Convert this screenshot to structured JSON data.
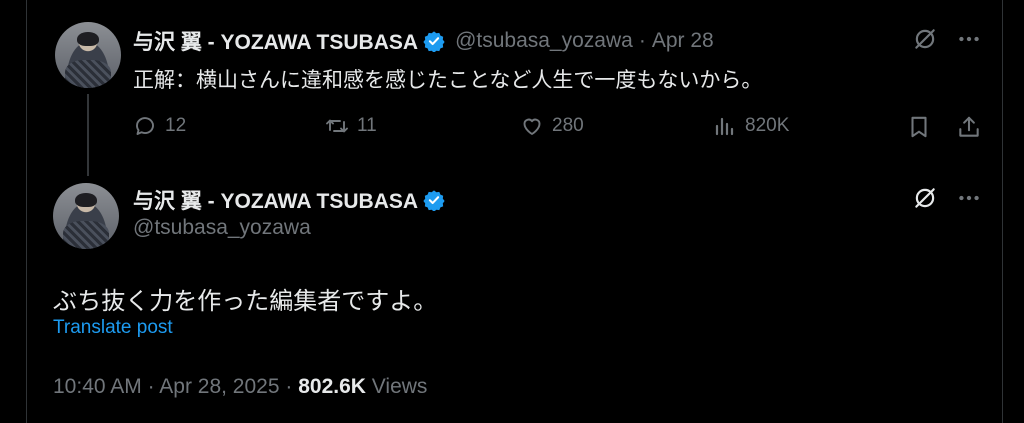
{
  "reply_tweet": {
    "display_name": "与沢 翼 - YOZAWA TSUBASA",
    "handle": "@tsubasa_yozawa",
    "separator": "·",
    "date": "Apr 28",
    "text": "正解：横山さんに違和感を感じたことなど人生で一度もないから。",
    "replies": "12",
    "reposts": "11",
    "likes": "280",
    "views": "820K"
  },
  "main_tweet": {
    "display_name": "与沢 翼 - YOZAWA TSUBASA",
    "handle": "@tsubasa_yozawa",
    "text": "ぶち抜く力を作った編集者ですよ。",
    "translate_label": "Translate post",
    "time": "10:40 AM",
    "dot": "·",
    "date": "Apr 28, 2025",
    "views_count": "802.6K",
    "views_label": "Views"
  },
  "icons": {
    "verified": "verified-badge-icon",
    "grok": "grok-icon",
    "more": "more-icon",
    "reply": "reply-icon",
    "repost": "repost-icon",
    "like": "like-icon",
    "views": "views-icon",
    "bookmark": "bookmark-icon",
    "share": "share-icon"
  },
  "colors": {
    "background": "#000000",
    "text": "#e7e9ea",
    "muted": "#71767b",
    "accent": "#1d9bf0"
  }
}
